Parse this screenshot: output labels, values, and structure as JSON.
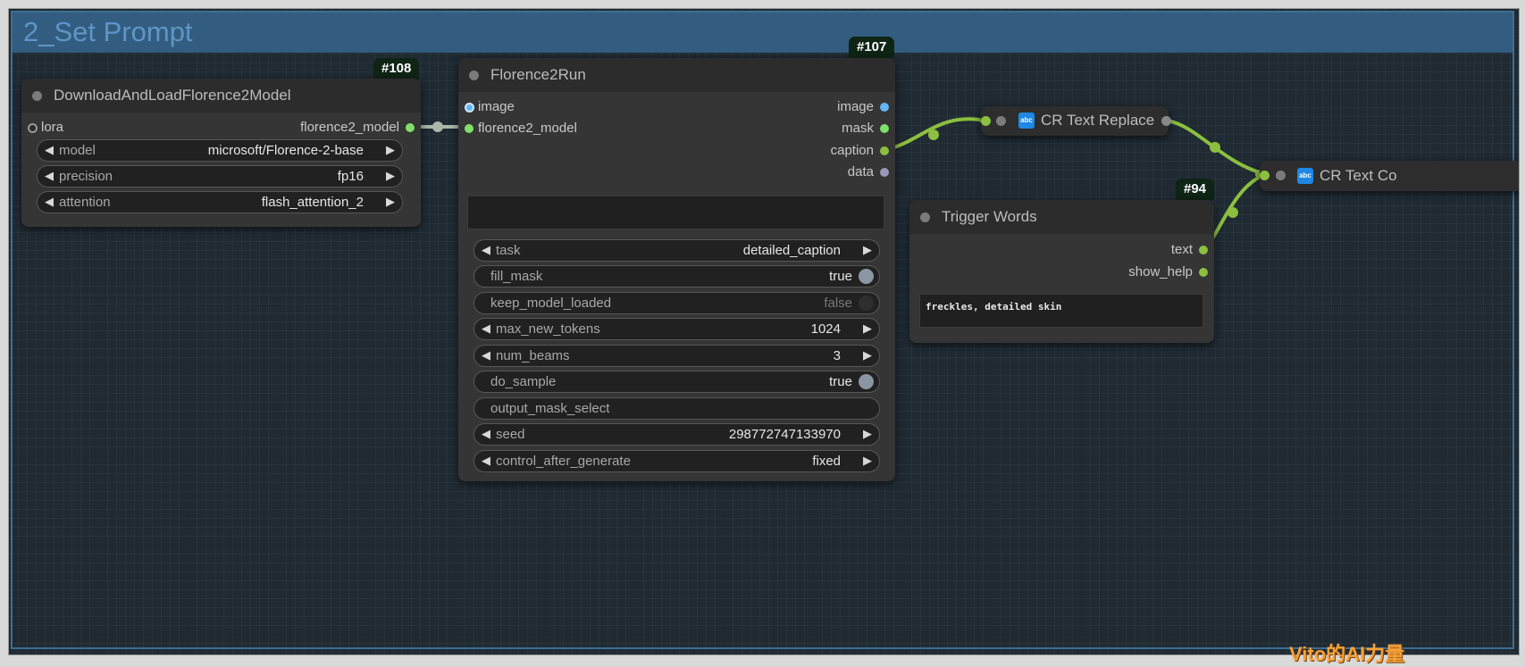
{
  "group": {
    "title": "2_Set Prompt"
  },
  "nodes": {
    "load_model": {
      "badge": "#108",
      "title": "DownloadAndLoadFlorence2Model",
      "input_lora": "lora",
      "output_model": "florence2_model",
      "widgets": [
        {
          "label": "model",
          "value": "microsoft/Florence-2-base"
        },
        {
          "label": "precision",
          "value": "fp16"
        },
        {
          "label": "attention",
          "value": "flash_attention_2"
        }
      ]
    },
    "florence_run": {
      "badge": "#107",
      "title": "Florence2Run",
      "inputs": {
        "image": "image",
        "model": "florence2_model"
      },
      "outputs": {
        "image": "image",
        "mask": "mask",
        "caption": "caption",
        "data": "data"
      },
      "widgets": {
        "task": {
          "label": "task",
          "value": "detailed_caption"
        },
        "fill_mask": {
          "label": "fill_mask",
          "value": "true"
        },
        "keep_model_loaded": {
          "label": "keep_model_loaded",
          "value": "false"
        },
        "max_new_tokens": {
          "label": "max_new_tokens",
          "value": "1024"
        },
        "num_beams": {
          "label": "num_beams",
          "value": "3"
        },
        "do_sample": {
          "label": "do_sample",
          "value": "true"
        },
        "output_mask_select": {
          "label": "output_mask_select"
        },
        "seed": {
          "label": "seed",
          "value": "298772747133970"
        },
        "control_after_generate": {
          "label": "control_after_generate",
          "value": "fixed"
        }
      }
    },
    "cr_text_replace": {
      "icon": "abc",
      "title": "CR Text Replace"
    },
    "cr_text_concat": {
      "icon": "abc",
      "title": "CR Text Co"
    },
    "trigger_words": {
      "badge": "#94",
      "title": "Trigger Words",
      "outputs": {
        "text": "text",
        "show_help": "show_help"
      },
      "text_value": "freckles, detailed skin"
    }
  },
  "colors": {
    "group_header": "#335d80",
    "group_title": "#5f95c4",
    "node_body": "#353535",
    "link_model": "#aab8aa",
    "link_string": "#8cbf3f",
    "slot_image": "#64b5f6",
    "slot_model": "#7ee06a",
    "slot_string": "#8cbf3f",
    "watermark": "#f5a13a"
  },
  "watermark": "Vito的AI力量"
}
